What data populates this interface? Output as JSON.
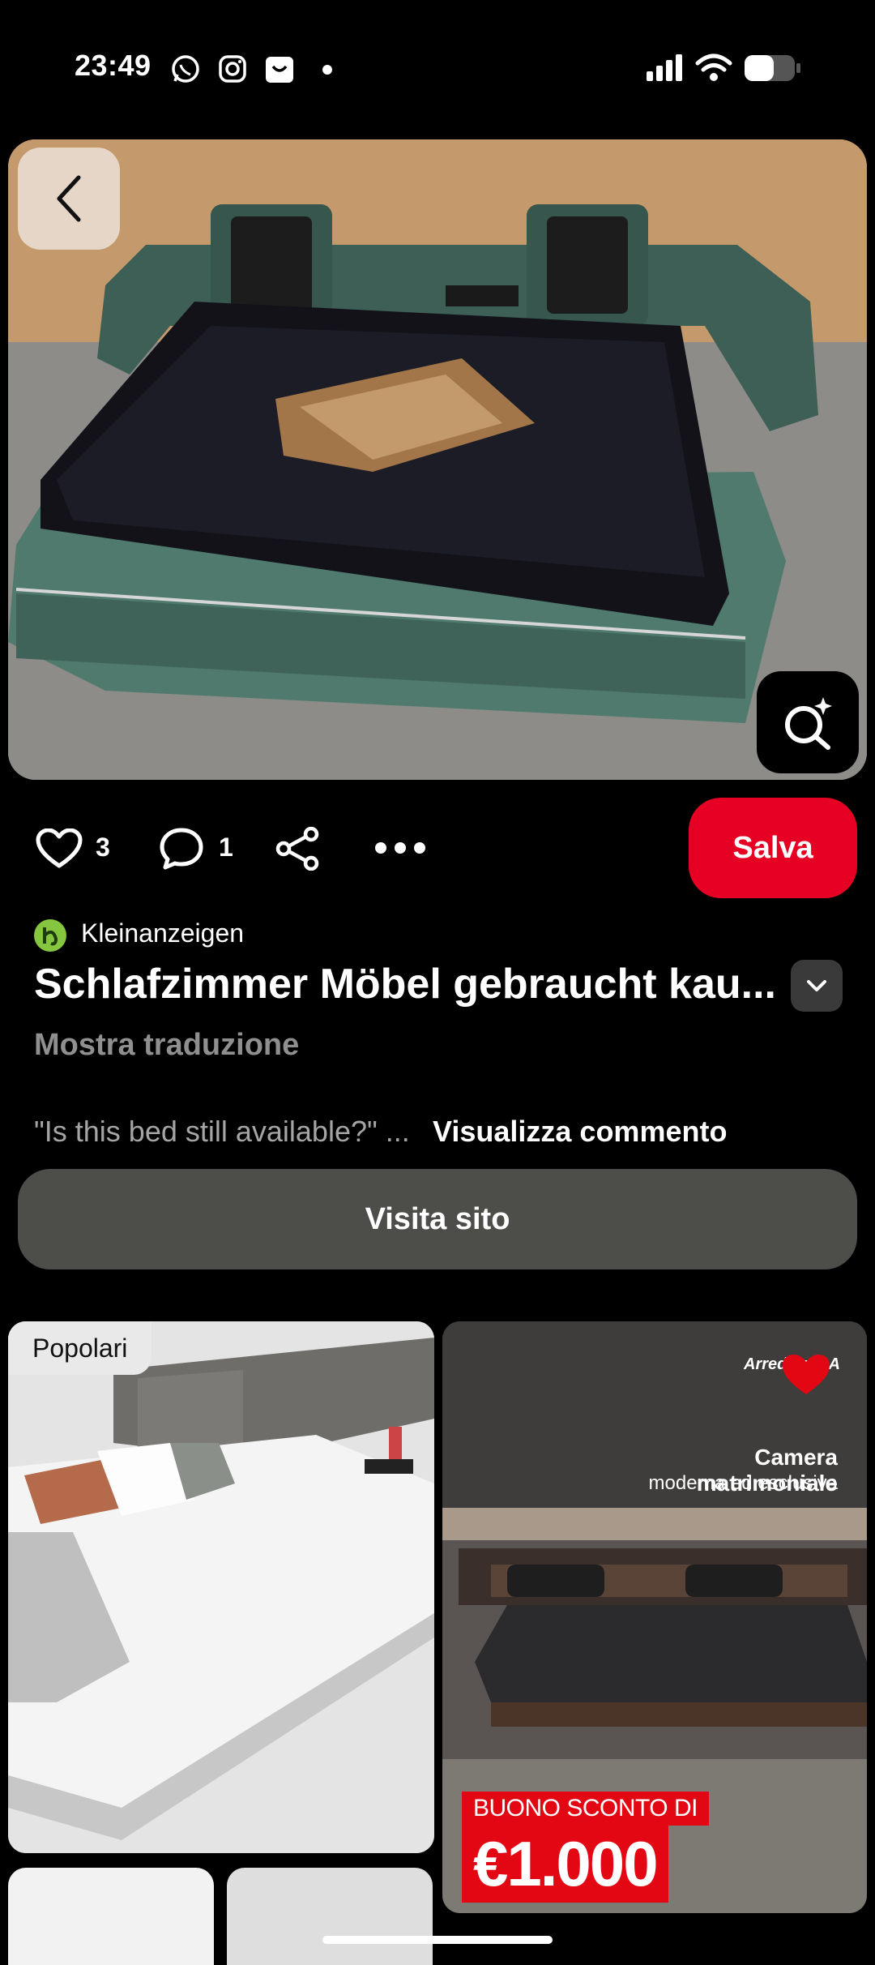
{
  "status_bar": {
    "time": "23:49",
    "icons": [
      "whatsapp-icon",
      "instagram-icon",
      "shopping-bag-icon",
      "dot-icon",
      "signal-icon",
      "wifi-icon",
      "battery-icon"
    ]
  },
  "hero": {
    "image": "green retro bed with black fur blanket and tan fur pillow"
  },
  "actions": {
    "like_count": "3",
    "comment_count": "1",
    "save_label": "Salva"
  },
  "source": {
    "name": "Kleinanzeigen"
  },
  "pin_title": "Schlafzimmer Möbel gebraucht kau...",
  "translate_label": "Mostra traduzione",
  "comment": {
    "preview": "\"Is this bed still available?\" ...",
    "link": "Visualizza commento"
  },
  "visit_label": "Visita sito",
  "grid": {
    "pin1": {
      "badge": "Popolari"
    },
    "pin2": {
      "brand": "ArredissimA",
      "title": "Camera matrimoniale",
      "subtitle": "moderna ed esclusiva",
      "promo1": "BUONO SCONTO DI",
      "promo2": "€1.000"
    }
  },
  "colors": {
    "save": "#e60023",
    "visit_bg": "#4d4e4a",
    "brand_green": "#86c540"
  }
}
